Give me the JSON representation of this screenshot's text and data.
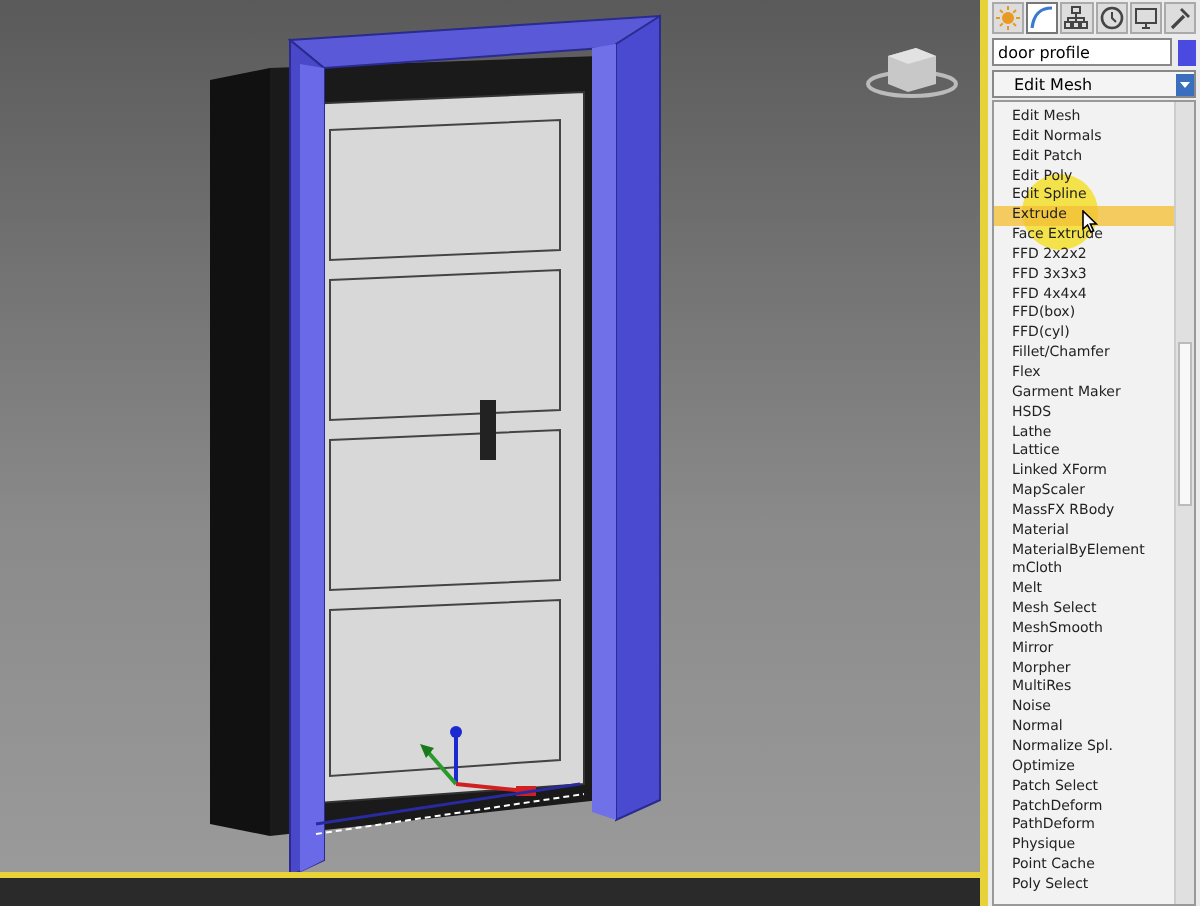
{
  "command_panel": {
    "tabs": [
      {
        "selected": false
      },
      {
        "selected": true
      },
      {
        "selected": false
      },
      {
        "selected": false
      },
      {
        "selected": false
      },
      {
        "selected": false
      }
    ],
    "object_name": {
      "value": "door profile",
      "color": "#4a4ae0"
    },
    "modifier_dropdown": {
      "value": "Edit Mesh"
    },
    "modifier_list": [
      {
        "label": "Edit Mesh",
        "selected": false
      },
      {
        "label": "Edit Normals",
        "selected": false
      },
      {
        "label": "Edit Patch",
        "selected": false
      },
      {
        "label": "Edit Poly",
        "selected": false
      },
      {
        "label": "Edit Spline",
        "selected": false
      },
      {
        "label": "Extrude",
        "selected": true
      },
      {
        "label": "Face Extrude",
        "selected": false
      },
      {
        "label": "FFD 2x2x2",
        "selected": false
      },
      {
        "label": "FFD 3x3x3",
        "selected": false
      },
      {
        "label": "FFD 4x4x4",
        "selected": false
      },
      {
        "label": "FFD(box)",
        "selected": false
      },
      {
        "label": "FFD(cyl)",
        "selected": false
      },
      {
        "label": "Fillet/Chamfer",
        "selected": false
      },
      {
        "label": "Flex",
        "selected": false
      },
      {
        "label": "Garment Maker",
        "selected": false
      },
      {
        "label": "HSDS",
        "selected": false
      },
      {
        "label": "Lathe",
        "selected": false
      },
      {
        "label": "Lattice",
        "selected": false
      },
      {
        "label": "Linked XForm",
        "selected": false
      },
      {
        "label": "MapScaler",
        "selected": false
      },
      {
        "label": "MassFX RBody",
        "selected": false
      },
      {
        "label": "Material",
        "selected": false
      },
      {
        "label": "MaterialByElement",
        "selected": false
      },
      {
        "label": "mCloth",
        "selected": false
      },
      {
        "label": "Melt",
        "selected": false
      },
      {
        "label": "Mesh Select",
        "selected": false
      },
      {
        "label": "MeshSmooth",
        "selected": false
      },
      {
        "label": "Mirror",
        "selected": false
      },
      {
        "label": "Morpher",
        "selected": false
      },
      {
        "label": "MultiRes",
        "selected": false
      },
      {
        "label": "Noise",
        "selected": false
      },
      {
        "label": "Normal",
        "selected": false
      },
      {
        "label": "Normalize Spl.",
        "selected": false
      },
      {
        "label": "Optimize",
        "selected": false
      },
      {
        "label": "Patch Select",
        "selected": false
      },
      {
        "label": "PatchDeform",
        "selected": false
      },
      {
        "label": "PathDeform",
        "selected": false
      },
      {
        "label": "Physique",
        "selected": false
      },
      {
        "label": "Point Cache",
        "selected": false
      },
      {
        "label": "Poly Select",
        "selected": false
      }
    ]
  }
}
